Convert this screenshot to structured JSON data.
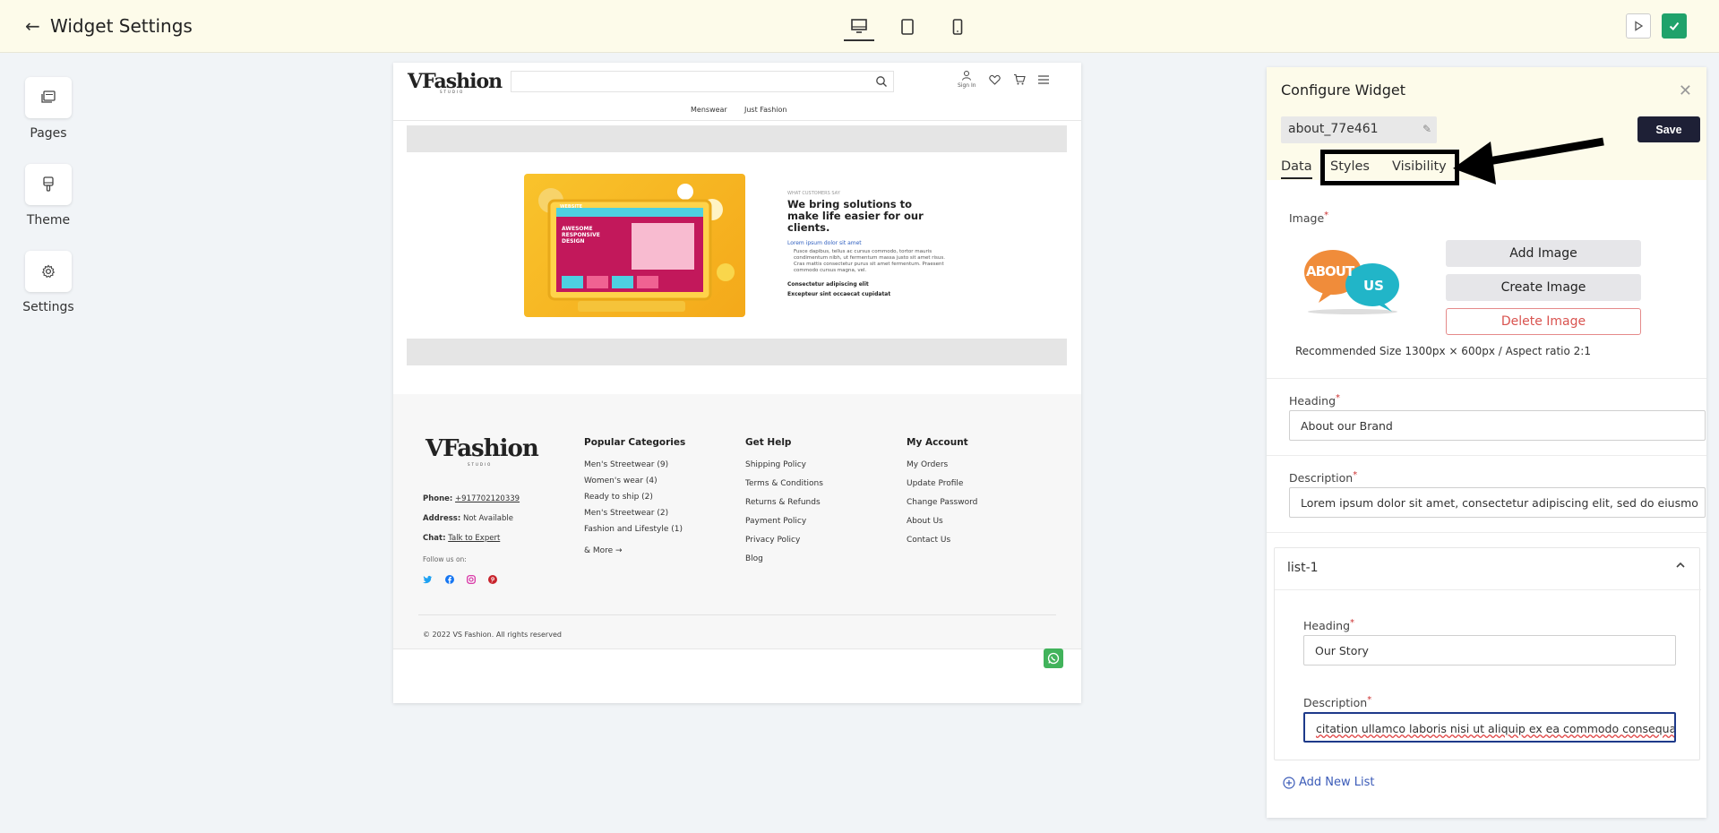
{
  "header": {
    "title": "Widget Settings",
    "devices": [
      "desktop",
      "tablet",
      "mobile"
    ]
  },
  "rail": {
    "items": [
      {
        "label": "Pages",
        "icon": "pages-icon"
      },
      {
        "label": "Theme",
        "icon": "theme-icon"
      },
      {
        "label": "Settings",
        "icon": "gear-icon"
      }
    ]
  },
  "preview": {
    "logo": "VFashion",
    "logo_sub": "STUDIO",
    "signin": "Sign In",
    "nav": [
      "Menswear",
      "Just Fashion"
    ],
    "hero": {
      "eyebrow": "WHAT CUSTOMERS SAY",
      "heading": "We bring solutions to make life easier for our clients.",
      "list_link": "Lorem ipsum dolor sit amet",
      "list_desc": "Fusce dapibus, tellus ac cursus commodo, tortor mauris condimentum nibh, ut fermentum massa justo sit amet risus. Cras mattis consectetur purus sit amet fermentum. Praesent commodo cursus magna, vel.",
      "list_b1": "Consectetur adipiscing elit",
      "list_b2": "Excepteur sint occaecat cupidatat",
      "screen_title": "WEBSITE",
      "screen_sub": "AWESOME RESPONSIVE DESIGN"
    },
    "footer": {
      "phone_label": "Phone:",
      "phone": "+917702120339",
      "address_label": "Address:",
      "address": "Not Available",
      "chat_label": "Chat:",
      "chat": "Talk to Expert",
      "follow": "Follow us on:",
      "copyright": "© 2022 VS Fashion. All rights reserved",
      "columns": [
        {
          "heading": "Popular Categories",
          "links": [
            "Men's Streetwear (9)",
            "Women's wear (4)",
            "Ready to ship (2)",
            "Men's Streetwear (2)",
            "Fashion and Lifestyle (1)"
          ],
          "more": "& More →"
        },
        {
          "heading": "Get Help",
          "links": [
            "Shipping Policy",
            "Terms & Conditions",
            "Returns & Refunds",
            "Payment Policy",
            "Privacy Policy",
            "Blog"
          ]
        },
        {
          "heading": "My Account",
          "links": [
            "My Orders",
            "Update Profile",
            "Change Password",
            "About Us",
            "Contact Us"
          ]
        }
      ]
    }
  },
  "panel": {
    "title": "Configure Widget",
    "widget_id": "about_77e461",
    "save_label": "Save",
    "tabs": [
      "Data",
      "Styles",
      "Visibility"
    ],
    "image_label": "Image",
    "about_text": "ABOUT",
    "us_text": "US",
    "add_image": "Add Image",
    "create_image": "Create Image",
    "delete_image": "Delete Image",
    "recommended": "Recommended Size 1300px × 600px / Aspect ratio 2:1",
    "heading_label": "Heading",
    "heading_value": "About our Brand",
    "description_label": "Description",
    "description_value": "Lorem ipsum dolor sit amet, consectetur adipiscing elit, sed do eiusmo",
    "list": {
      "title": "list-1",
      "heading_label": "Heading",
      "heading_value": "Our Story",
      "description_label": "Description",
      "description_value": "citation ullamco laboris nisi ut aliquip ex ea commodo consequat."
    },
    "add_list": "Add New List"
  }
}
